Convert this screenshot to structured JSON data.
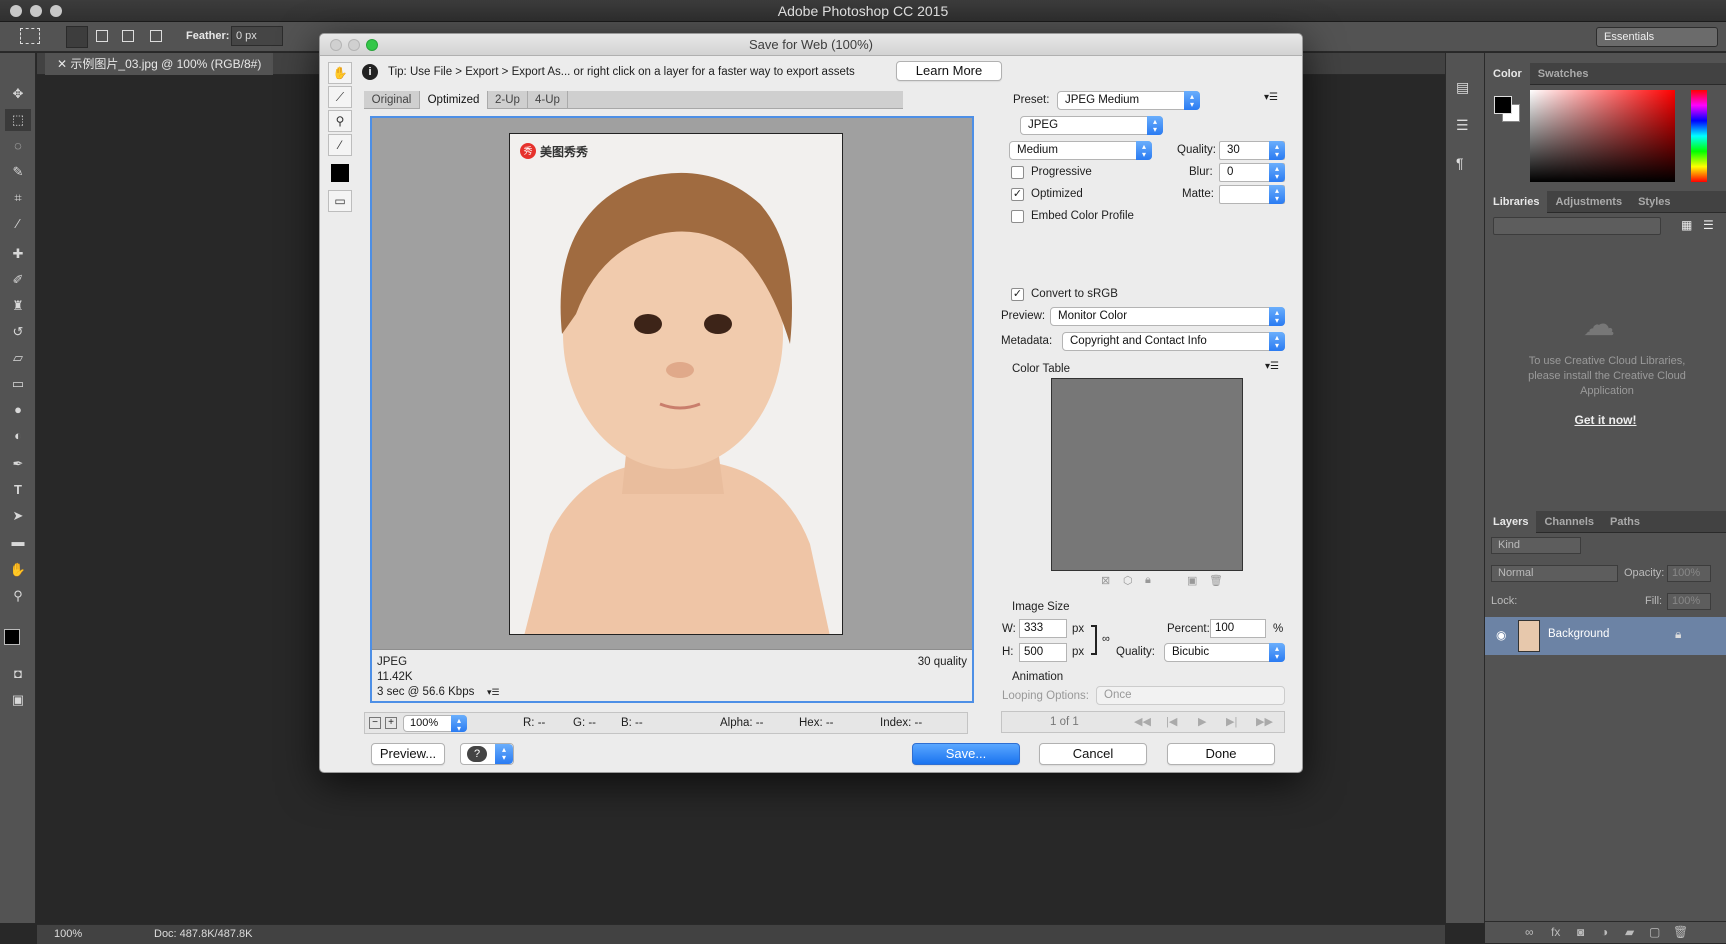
{
  "app": {
    "title": "Adobe Photoshop CC 2015"
  },
  "options": {
    "feather_label": "Feather:",
    "feather_value": "0 px",
    "workspace": "Essentials"
  },
  "document": {
    "tab": "示例图片_03.jpg @ 100% (RGB/8#)"
  },
  "status": {
    "zoom": "100%",
    "doc": "Doc: 487.8K/487.8K"
  },
  "panels": {
    "color_tabs": [
      "Color",
      "Swatches"
    ],
    "lib_tabs": [
      "Libraries",
      "Adjustments",
      "Styles"
    ],
    "cc_message": "To use Creative Cloud Libraries, please install the Creative Cloud Application",
    "cc_link": "Get it now!",
    "layer_tabs": [
      "Layers",
      "Channels",
      "Paths"
    ],
    "kind": "Kind",
    "blend": "Normal",
    "opacity_label": "Opacity:",
    "opacity": "100%",
    "lock_label": "Lock:",
    "fill_label": "Fill:",
    "fill": "100%",
    "layer_name": "Background"
  },
  "dialog": {
    "title": "Save for Web (100%)",
    "tip": "Tip: Use File > Export > Export As...  or right click on a layer for a faster way to export assets",
    "learn_more": "Learn More",
    "view_tabs": [
      "Original",
      "Optimized",
      "2-Up",
      "4-Up"
    ],
    "watermark": "美图秀秀",
    "info_format": "JPEG",
    "info_size": "11.42K",
    "info_time": "3 sec @ 56.6 Kbps",
    "info_quality": "30 quality",
    "zoom": "100%",
    "r": "R: --",
    "g": "G: --",
    "b": "B: --",
    "alpha": "Alpha: --",
    "hex": "Hex: --",
    "index": "Index: --",
    "preview_btn": "Preview...",
    "save_btn": "Save...",
    "cancel_btn": "Cancel",
    "done_btn": "Done",
    "preset_label": "Preset:",
    "preset": "JPEG Medium",
    "format": "JPEG",
    "quality_level": "Medium",
    "quality_label": "Quality:",
    "quality": "30",
    "blur_label": "Blur:",
    "blur": "0",
    "matte_label": "Matte:",
    "progressive": "Progressive",
    "optimized": "Optimized",
    "embed": "Embed Color Profile",
    "convert": "Convert to sRGB",
    "preview_label": "Preview:",
    "preview_value": "Monitor Color",
    "metadata_label": "Metadata:",
    "metadata_value": "Copyright and Contact Info",
    "color_table": "Color Table",
    "image_size": "Image Size",
    "w_label": "W:",
    "w": "333",
    "h_label": "H:",
    "h": "500",
    "px": "px",
    "percent_label": "Percent:",
    "percent": "100",
    "pct": "%",
    "resample_label": "Quality:",
    "resample": "Bicubic",
    "animation": "Animation",
    "looping_label": "Looping Options:",
    "looping": "Once",
    "frame": "1 of 1"
  }
}
